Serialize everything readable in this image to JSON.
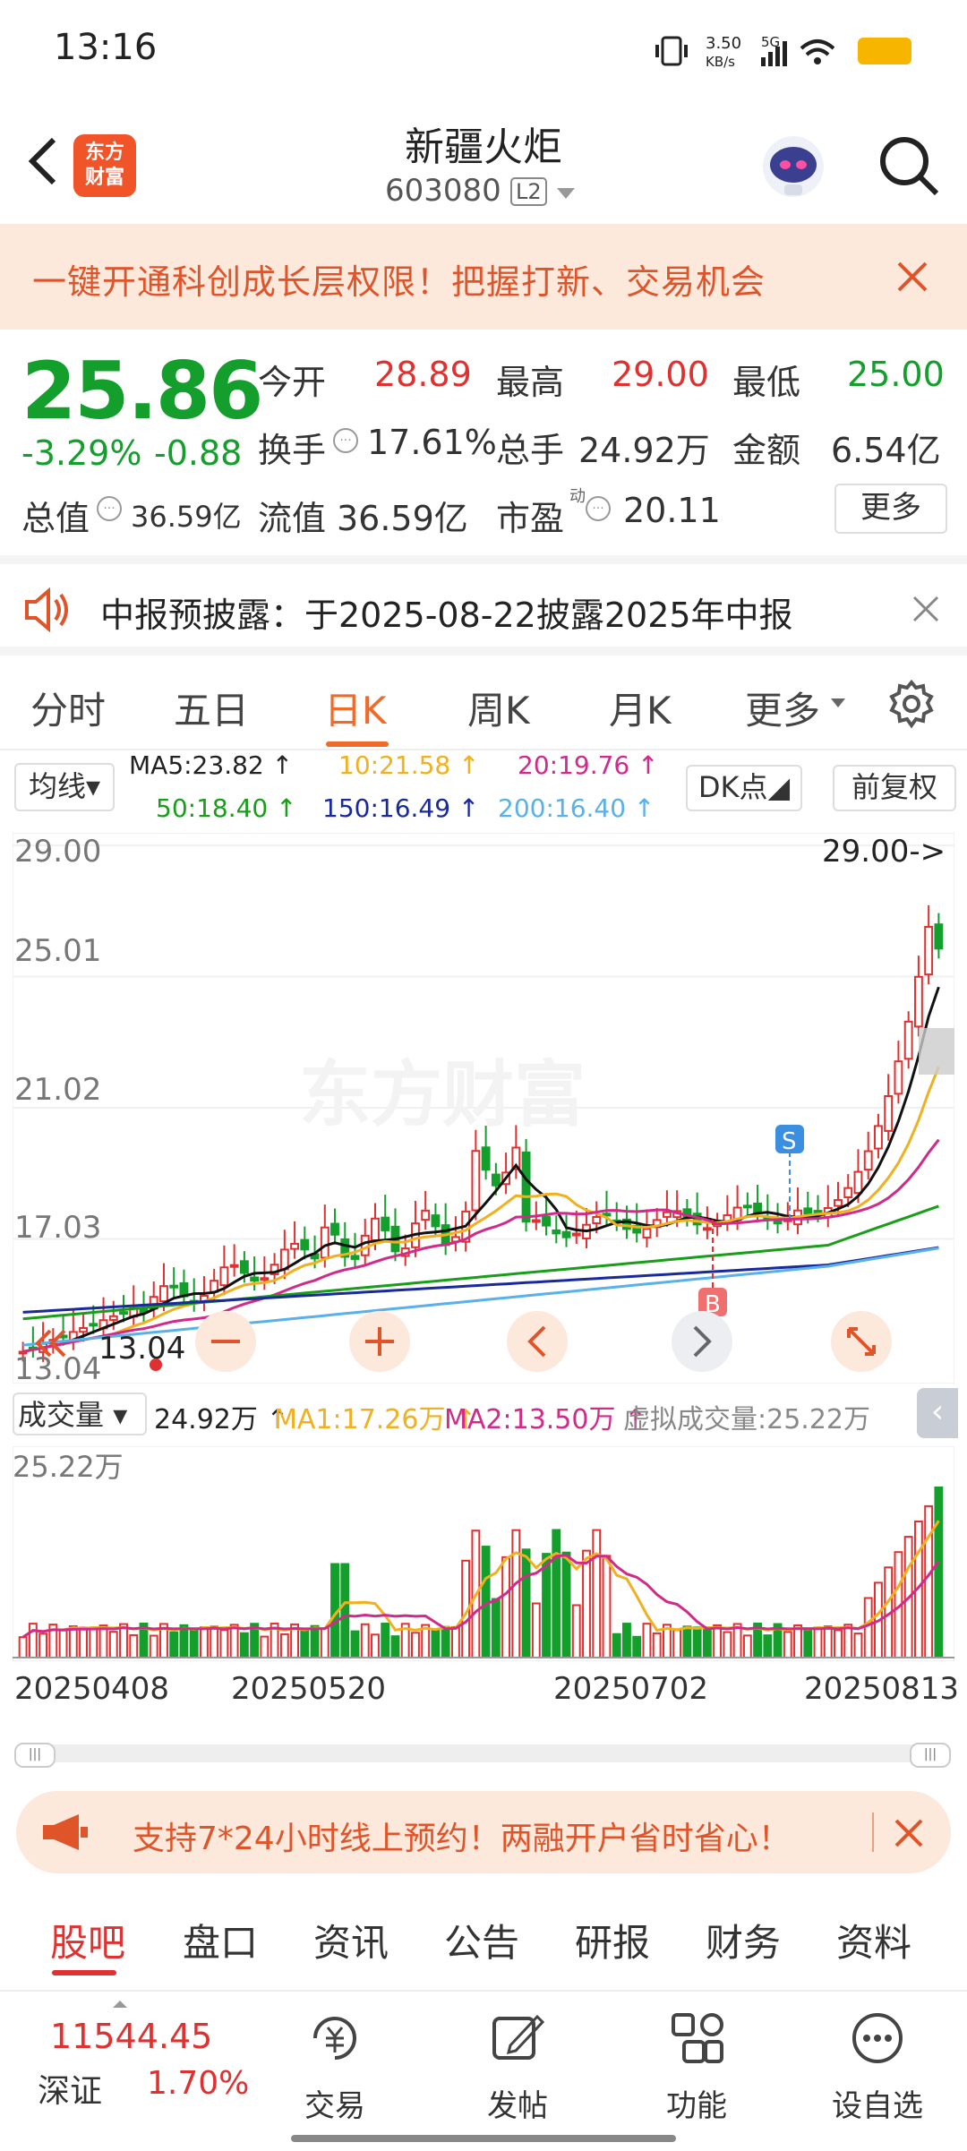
{
  "status": {
    "time": "13:16",
    "net_speed": "3.50",
    "net_unit": "KB/s",
    "signal": "5G"
  },
  "header": {
    "logo_line1": "东方",
    "logo_line2": "财富",
    "stock_name": "新疆火炬",
    "stock_code": "603080",
    "level": "L2"
  },
  "banner": {
    "text": "一键开通科创成长层权限！把握打新、交易机会"
  },
  "quote": {
    "price": "25.86",
    "change_pct": "-3.29%",
    "change": "-0.88",
    "open_label": "今开",
    "open": "28.89",
    "high_label": "最高",
    "high": "29.00",
    "low_label": "最低",
    "low": "25.00",
    "turnover_label": "换手",
    "turnover": "17.61%",
    "volume_label": "总手",
    "volume": "24.92万",
    "amount_label": "金额",
    "amount": "6.54亿",
    "mktcap_label": "总值",
    "mktcap": "36.59亿",
    "float_label": "流值",
    "float": "36.59亿",
    "pe_label": "市盈",
    "pe_sup": "动",
    "pe": "20.11",
    "more": "更多"
  },
  "notice": {
    "text": "中报预披露：于2025-08-22披露2025年中报"
  },
  "ktabs": [
    "分时",
    "五日",
    "日K",
    "周K",
    "月K",
    "更多"
  ],
  "ma": {
    "select": "均线",
    "ma5": "MA5:23.82 ↑",
    "ma10": "10:21.58 ↑",
    "ma20": "20:19.76 ↑",
    "ma50": "50:18.40 ↑",
    "ma150": "150:16.49 ↑",
    "ma200": "200:16.40 ↑",
    "dk": "DK点",
    "adj": "前复权"
  },
  "colors": {
    "up": "#e0302f",
    "down": "#149e2c",
    "ma5": "#111111",
    "ma10": "#f0b020",
    "ma20": "#d02a8a",
    "ma50": "#1a9e1a",
    "ma150": "#1a2a9a",
    "ma200": "#5ab0e8"
  },
  "chart_data": {
    "type": "candlestick",
    "y_ticks": [
      "29.00",
      "25.01",
      "21.02",
      "17.03",
      "13.04"
    ],
    "ylim": [
      13.04,
      29.0
    ],
    "max_label": "29.00->",
    "min_label": "13.04",
    "buy_marker": "B",
    "sell_marker": "S",
    "x_labels": [
      "20250408",
      "20250520",
      "20250702",
      "20250813"
    ],
    "last_close": 25.86
  },
  "volume": {
    "select": "成交量",
    "total": "24.92万 ↑",
    "ma1": "MA1:17.26万 ↑",
    "ma2": "MA2:13.50万 ↑",
    "virtual": "虚拟成交量:25.22万",
    "max_label": "25.22万"
  },
  "promo": {
    "text": "支持7*24小时线上预约！两融开户省时省心！"
  },
  "btabs": [
    "股吧",
    "盘口",
    "资讯",
    "公告",
    "研报",
    "财务",
    "资料"
  ],
  "nav": {
    "index_value": "11544.45",
    "index_name": "深证",
    "index_pct": "1.70%",
    "items": [
      "交易",
      "发帖",
      "功能",
      "设自选"
    ]
  }
}
